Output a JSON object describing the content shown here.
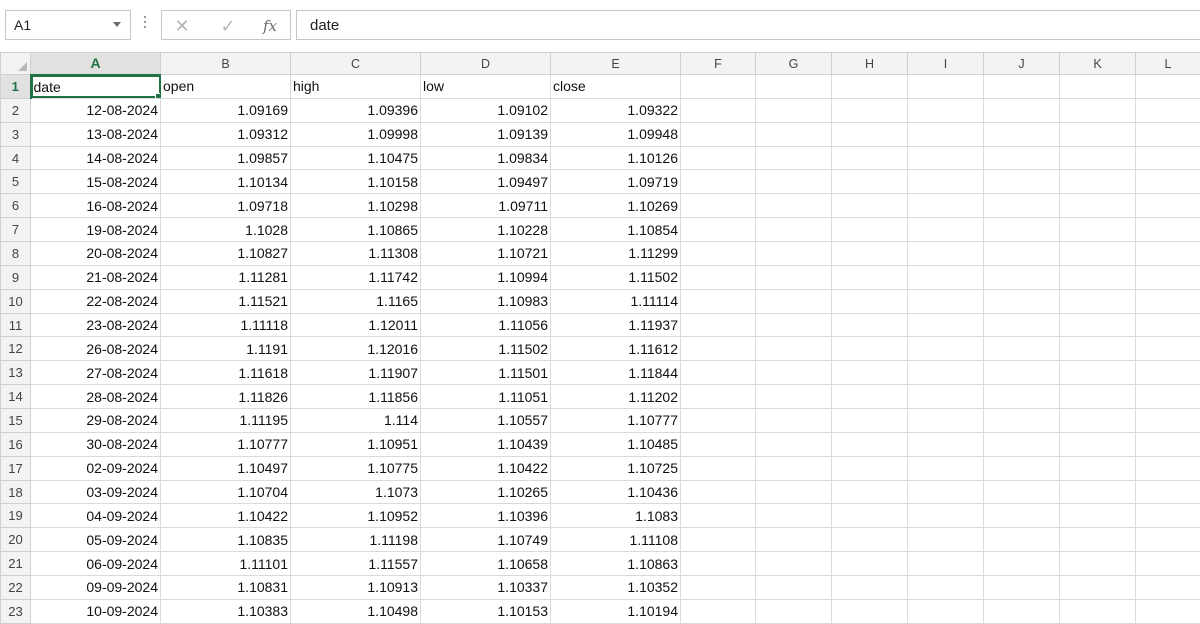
{
  "formula_bar": {
    "name_box": "A1",
    "cancel_glyph": "✕",
    "enter_glyph": "✓",
    "function_glyph": "fx",
    "formula": "date"
  },
  "icons": [
    "name-box-dropdown-icon",
    "more-options-icon",
    "cancel-icon",
    "enter-icon",
    "insert-function-icon",
    "select-all-icon"
  ],
  "colors": {
    "accent": "#217346",
    "header_bg": "#f3f3f3",
    "gridline": "#dadada"
  },
  "grid": {
    "columns": [
      "A",
      "B",
      "C",
      "D",
      "E",
      "F",
      "G",
      "H",
      "I",
      "J",
      "K",
      "L"
    ],
    "row_numbers": [
      "1",
      "2",
      "3",
      "4",
      "5",
      "6",
      "7",
      "8",
      "9",
      "10",
      "11",
      "12",
      "13",
      "14",
      "15",
      "16",
      "17",
      "18",
      "19",
      "20",
      "21",
      "22",
      "23"
    ],
    "header": [
      "date",
      "open",
      "high",
      "low",
      "close"
    ],
    "rows": [
      [
        "12-08-2024",
        "1.09169",
        "1.09396",
        "1.09102",
        "1.09322"
      ],
      [
        "13-08-2024",
        "1.09312",
        "1.09998",
        "1.09139",
        "1.09948"
      ],
      [
        "14-08-2024",
        "1.09857",
        "1.10475",
        "1.09834",
        "1.10126"
      ],
      [
        "15-08-2024",
        "1.10134",
        "1.10158",
        "1.09497",
        "1.09719"
      ],
      [
        "16-08-2024",
        "1.09718",
        "1.10298",
        "1.09711",
        "1.10269"
      ],
      [
        "19-08-2024",
        "1.1028",
        "1.10865",
        "1.10228",
        "1.10854"
      ],
      [
        "20-08-2024",
        "1.10827",
        "1.11308",
        "1.10721",
        "1.11299"
      ],
      [
        "21-08-2024",
        "1.11281",
        "1.11742",
        "1.10994",
        "1.11502"
      ],
      [
        "22-08-2024",
        "1.11521",
        "1.1165",
        "1.10983",
        "1.11114"
      ],
      [
        "23-08-2024",
        "1.11118",
        "1.12011",
        "1.11056",
        "1.11937"
      ],
      [
        "26-08-2024",
        "1.1191",
        "1.12016",
        "1.11502",
        "1.11612"
      ],
      [
        "27-08-2024",
        "1.11618",
        "1.11907",
        "1.11501",
        "1.11844"
      ],
      [
        "28-08-2024",
        "1.11826",
        "1.11856",
        "1.11051",
        "1.11202"
      ],
      [
        "29-08-2024",
        "1.11195",
        "1.114",
        "1.10557",
        "1.10777"
      ],
      [
        "30-08-2024",
        "1.10777",
        "1.10951",
        "1.10439",
        "1.10485"
      ],
      [
        "02-09-2024",
        "1.10497",
        "1.10775",
        "1.10422",
        "1.10725"
      ],
      [
        "03-09-2024",
        "1.10704",
        "1.1073",
        "1.10265",
        "1.10436"
      ],
      [
        "04-09-2024",
        "1.10422",
        "1.10952",
        "1.10396",
        "1.1083"
      ],
      [
        "05-09-2024",
        "1.10835",
        "1.11198",
        "1.10749",
        "1.11108"
      ],
      [
        "06-09-2024",
        "1.11101",
        "1.11557",
        "1.10658",
        "1.10863"
      ],
      [
        "09-09-2024",
        "1.10831",
        "1.10913",
        "1.10337",
        "1.10352"
      ],
      [
        "10-09-2024",
        "1.10383",
        "1.10498",
        "1.10153",
        "1.10194"
      ]
    ]
  }
}
